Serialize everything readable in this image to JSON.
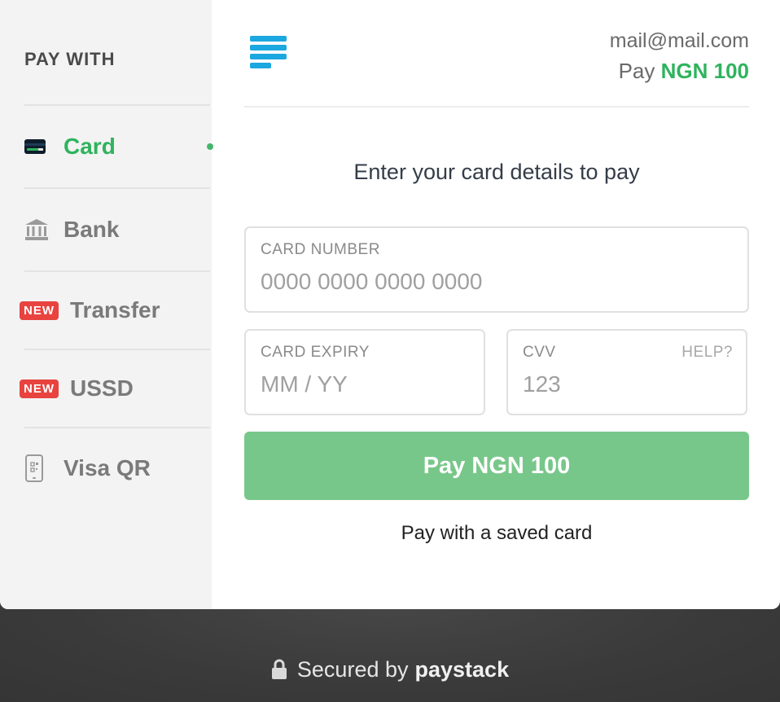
{
  "sidebar": {
    "title": "PAY WITH",
    "items": [
      {
        "label": "Card",
        "icon": "credit-card-icon",
        "active": true
      },
      {
        "label": "Bank",
        "icon": "bank-icon"
      },
      {
        "label": "Transfer",
        "icon": "new-badge",
        "badge": "NEW"
      },
      {
        "label": "USSD",
        "icon": "new-badge",
        "badge": "NEW"
      },
      {
        "label": "Visa QR",
        "icon": "qr-phone-icon"
      }
    ]
  },
  "header": {
    "logo": "paystack-logo-icon",
    "email": "mail@mail.com",
    "pay_prefix": "Pay",
    "amount": "NGN 100"
  },
  "form": {
    "instruction": "Enter your card details to pay",
    "card_number": {
      "label": "CARD NUMBER",
      "placeholder": "0000 0000 0000 0000"
    },
    "card_expiry": {
      "label": "CARD EXPIRY",
      "placeholder": "MM / YY"
    },
    "cvv": {
      "label": "CVV",
      "placeholder": "123",
      "help": "HELP?"
    },
    "pay_button": "Pay NGN 100",
    "saved_card_link": "Pay with a saved card"
  },
  "footer": {
    "secured_by": "Secured by",
    "brand": "paystack"
  },
  "colors": {
    "accent": "#2fb35d",
    "button": "#78c78a",
    "badge": "#e8433f",
    "logo": "#1ba7e0"
  }
}
